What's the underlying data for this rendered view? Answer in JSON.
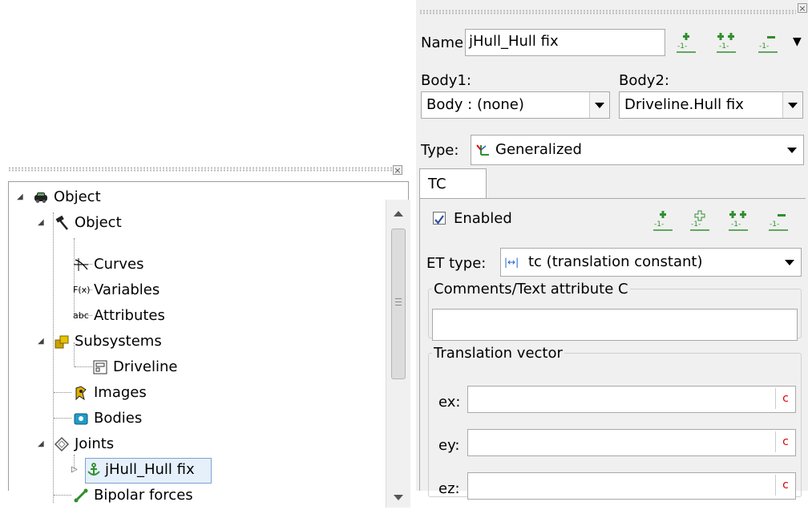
{
  "tree": {
    "root": {
      "label": "Object"
    },
    "items": [
      {
        "label": "Object"
      },
      {
        "label": "Curves"
      },
      {
        "label": "Variables"
      },
      {
        "label": "Attributes"
      },
      {
        "label": "Subsystems"
      },
      {
        "label": "Driveline"
      },
      {
        "label": "Images"
      },
      {
        "label": "Bodies"
      },
      {
        "label": "Joints"
      },
      {
        "label": "jHull_Hull fix"
      },
      {
        "label": "Bipolar forces"
      }
    ]
  },
  "properties": {
    "name_label": "Name",
    "name_value": "jHull_Hull fix",
    "body1_label": "Body1:",
    "body1_value": "Body : (none)",
    "body2_label": "Body2:",
    "body2_value": "Driveline.Hull fix",
    "type_label": "Type:",
    "type_value": "Generalized",
    "tab_label": "TC",
    "enabled_label": "Enabled",
    "enabled_checked": true,
    "et_type_label": "ET type:",
    "et_type_value": "tc (translation constant)",
    "comments_legend": "Comments/Text attribute C",
    "translation_legend": "Translation vector",
    "vector_fields": [
      {
        "label": "ex:",
        "value": "",
        "btn": "c"
      },
      {
        "label": "ey:",
        "value": "",
        "btn": "c"
      },
      {
        "label": "ez:",
        "value": "",
        "btn": "c"
      }
    ]
  },
  "colors": {
    "panel_bg": "#f0f0f0",
    "selection": "#e5f0fb",
    "icon_green": "#2f8f2f",
    "c_button_red": "#dd0000"
  }
}
